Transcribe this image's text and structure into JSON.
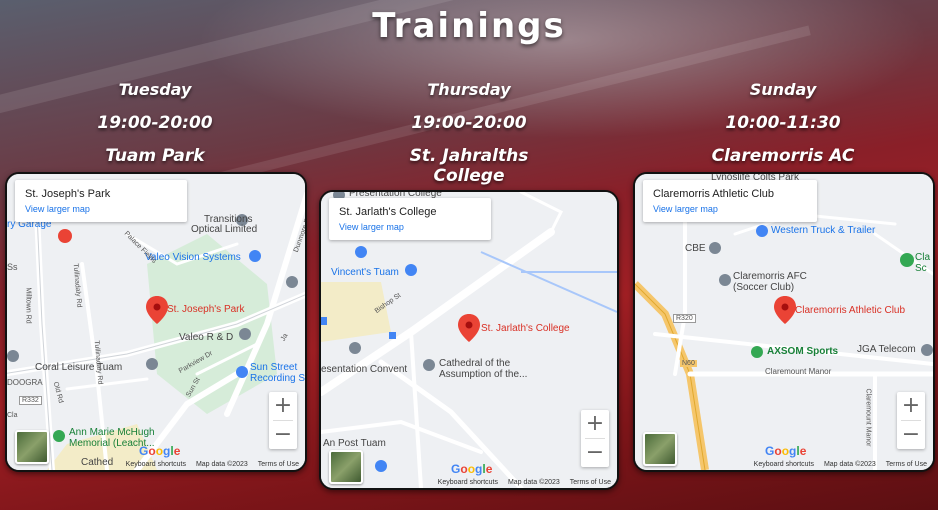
{
  "page": {
    "title": "Trainings"
  },
  "sessions": [
    {
      "day": "Tuesday",
      "time": "19:00-20:00",
      "venue": "Tuam Park",
      "map": {
        "place": "St. Joseph's Park",
        "link": "View larger map",
        "pin_label": "St. Joseph's Park",
        "labels": {
          "a": "Transitions",
          "b": "Optical Limited",
          "c": "ry Garage",
          "d": "Valeo Vision Systems",
          "e": "Valeo R & D",
          "f": "Coral Leisure Tuam",
          "g": "Sun Street",
          "h": "Recording S",
          "i": "Ann Marie McHugh",
          "j": "Memorial (Leacht...",
          "k": "Cathed",
          "r1": "Dunmore Rd",
          "r2": "Milltown Rd",
          "r3": "Old Rd",
          "r4": "Sun St",
          "r5": "Parkview Dr",
          "r6": "Palace Fields",
          "r7": "Tullinadaly Rd",
          "r8": "DOOGRA",
          "r9": "R332",
          "r10": "Ss",
          "r11": "Tullinadaly Rd",
          "r12": "Ja",
          "r13": "Cla"
        },
        "footer": [
          "Keyboard shortcuts",
          "Map data ©2023",
          "Terms of Use"
        ]
      }
    },
    {
      "day": "Thursday",
      "time": "19:00-20:00",
      "venue": "St. Jahralths College",
      "map": {
        "place": "St. Jarlath's College",
        "link": "View larger map",
        "pin_label": "St. Jarlath's College",
        "labels": {
          "a": "Presentation College",
          "b": "Vincent's Tuam",
          "c": "Cathedral of the",
          "d": "Assumption of the...",
          "e": "esentation Convent",
          "f": "An Post Tuam",
          "r1": "Bishop St"
        },
        "footer": [
          "Keyboard shortcuts",
          "Map data ©2023",
          "Terms of Use"
        ]
      }
    },
    {
      "day": "Sunday",
      "time": "10:00-11:30",
      "venue": "Claremorris AC",
      "map": {
        "place": "Claremorris Athletic Club",
        "link": "View larger map",
        "pin_label": "Claremorris Athletic Club",
        "labels": {
          "a": "Lynoslife Colts Park",
          "b": "Western Truck & Trailer",
          "c": "CBE",
          "d": "Claremorris AFC",
          "e": "(Soccer Club)",
          "f": "AXSOM Sports",
          "g": "JGA Telecom",
          "h": "Claremount Manor",
          "i": "Cla",
          "j": "Sc",
          "r1": "R320",
          "r2": "N60",
          "r3": "Claremount Manor"
        },
        "footer": [
          "Keyboard shortcuts",
          "Map data ©2023",
          "Terms of Use"
        ]
      }
    }
  ],
  "controls": {
    "zoom_in": "+",
    "zoom_out": "−",
    "google": [
      "G",
      "o",
      "o",
      "g",
      "l",
      "e"
    ]
  },
  "colors": {
    "pin": "#ea4335",
    "link": "#1a73e8",
    "title": "#ffffff"
  }
}
